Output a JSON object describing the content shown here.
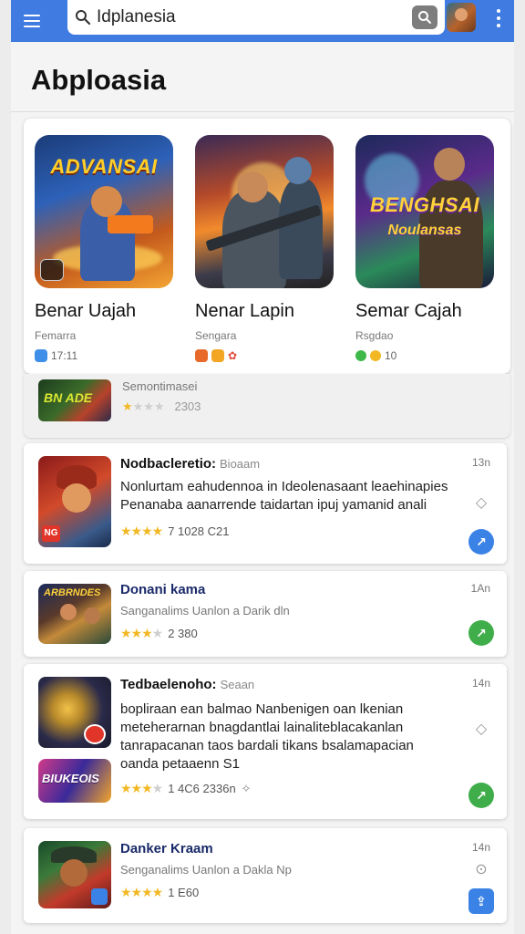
{
  "search": {
    "value": "Idplanesia"
  },
  "page_title": "Abploasia",
  "featured": [
    {
      "logo": "ADVANSAI",
      "logo_sub": "",
      "name": "Benar Uajah",
      "sub": "Femarra",
      "meta": "17:11",
      "chip_color": "#3f8ee8"
    },
    {
      "logo": "",
      "logo_sub": "",
      "name": "Nenar Lapin",
      "sub": "Sengara",
      "meta": "",
      "chip_color": "#e86a2a"
    },
    {
      "logo": "BENGHSAI",
      "logo_sub": "Noulansas",
      "name": "Semar Cajah",
      "sub": "Rsgdao",
      "meta": "10",
      "chip_color": "#3fb84a"
    }
  ],
  "mini": {
    "name": "Semontimasei",
    "meta": "2303"
  },
  "list": [
    {
      "title": "Nodbacleretio:",
      "title_extra": "Bioaam",
      "desc": "Nonlurtam eahudennoa in Ideolenasaant leaehinapies Penanaba aanarrende taidartan ipuj yamanid anali",
      "rating_text": "7 1028   C21",
      "stars": 4,
      "time": "13n",
      "action_color": "#3b82e6",
      "action_glyph": "↗"
    },
    {
      "title": "Donani kama",
      "title_extra": "",
      "sub": "Sanganalims Uanlon a Darik dln",
      "rating_text": "2 380",
      "stars": 3,
      "time": "1An",
      "action_color": "#3fae4a",
      "action_glyph": "↗"
    },
    {
      "title": "Tedbaelenoho:",
      "title_extra": "Seaan",
      "desc": "bopliraan ean balmao Nanbenigen oan lkenian meteherarnan bnagdantlai lainaliteblacakanlan tanrapacanan taos bardali tikans bsalamapacian oanda petaaenn S1",
      "rating_text": "1 4C6   2336n",
      "stars": 3,
      "time": "14n",
      "action_color": "#3fae4a",
      "action_glyph": "↗",
      "second_logo": "BIUKEOIS"
    },
    {
      "title": "Danker Kraam",
      "title_extra": "",
      "sub": "Senganalims Uanlon a Dakla Np",
      "rating_text": "1 E60",
      "stars": 4,
      "time": "14n",
      "action_color": "#3b82e6",
      "action_glyph": "⇪"
    }
  ]
}
